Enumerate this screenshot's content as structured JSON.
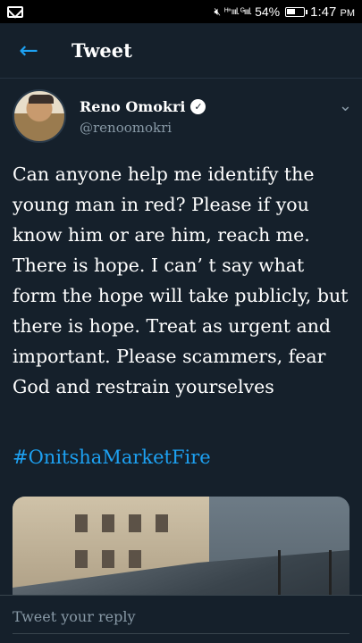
{
  "status_bar": {
    "mail_icon": "mail-icon",
    "network_text": "ᴴ⁺ıııl. ᴳıııl.",
    "battery": "54%",
    "battery_level": 0.54,
    "time": "1:47",
    "ampm": "PM"
  },
  "app_bar": {
    "back_icon": "arrow-left-icon",
    "title": "Tweet"
  },
  "tweet": {
    "author_name": "Reno Omokri",
    "handle": "@renoomokri",
    "verified_icon": "verified-check-icon",
    "menu_icon": "chevron-down-icon",
    "text": "Can anyone help me identify the young man in red? Please if you know him or are him, reach me. There is hope. I can’ t say what form the hope will take publicly, but there is hope. Treat as urgent and important. Please scammers, fear God and restrain yourselves",
    "hashtag": "#OnitshaMarketFire"
  },
  "reply": {
    "placeholder": "Tweet your reply"
  },
  "colors": {
    "background": "#15202b",
    "accent": "#1da1f2",
    "secondary_text": "#8899a6"
  }
}
